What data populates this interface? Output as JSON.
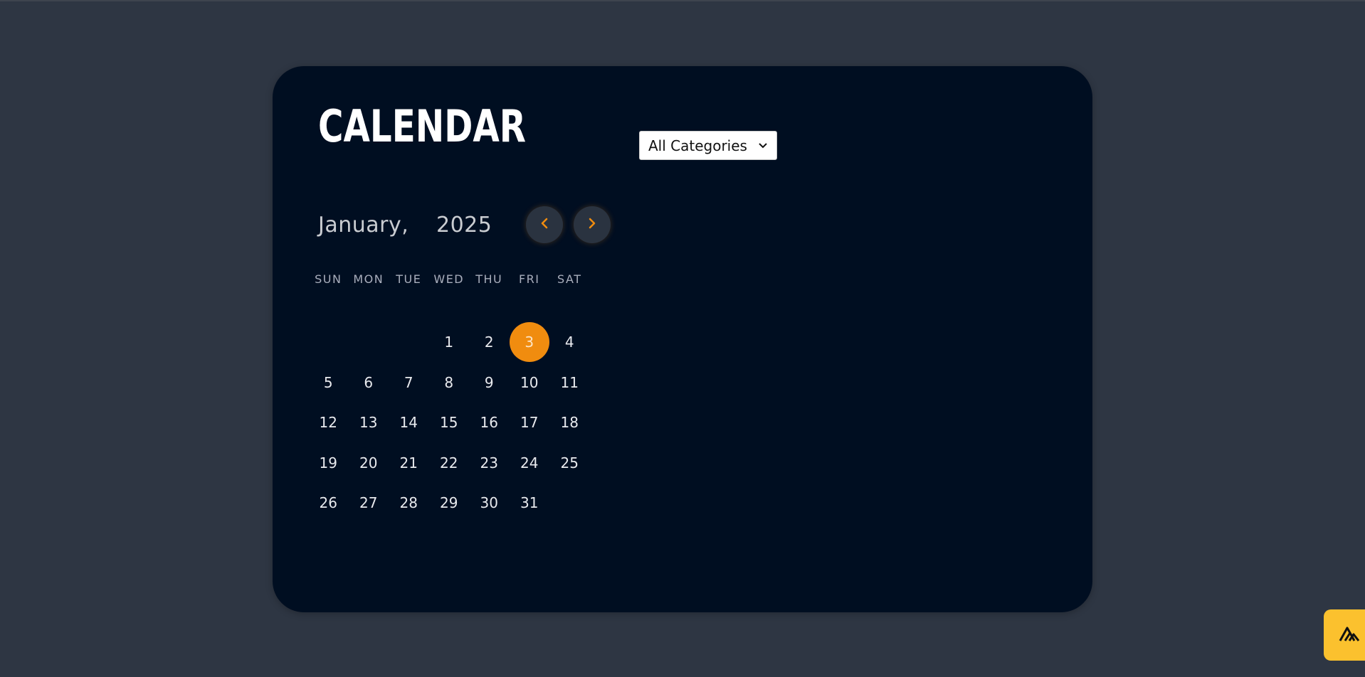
{
  "calendar": {
    "title": "CALENDAR",
    "month": "January,",
    "year": "2025",
    "weekdays": [
      "SUN",
      "MON",
      "TUE",
      "WED",
      "THU",
      "FRI",
      "SAT"
    ],
    "days": [
      "",
      "",
      "",
      "1",
      "2",
      "3",
      "4",
      "5",
      "6",
      "7",
      "8",
      "9",
      "10",
      "11",
      "12",
      "13",
      "14",
      "15",
      "16",
      "17",
      "18",
      "19",
      "20",
      "21",
      "22",
      "23",
      "24",
      "25",
      "26",
      "27",
      "28",
      "29",
      "30",
      "31",
      ""
    ],
    "selected_day": "3",
    "prev_icon": "chevron-left-icon",
    "next_icon": "chevron-right-icon"
  },
  "filter": {
    "selected": "All Categories",
    "icon": "chevron-down-icon"
  },
  "widget": {
    "icon": "mountain-logo-icon"
  },
  "colors": {
    "page_bg": "#2e3643",
    "card_bg": "#000e21",
    "accent": "#f08c0f",
    "widget": "#fbc12e"
  }
}
